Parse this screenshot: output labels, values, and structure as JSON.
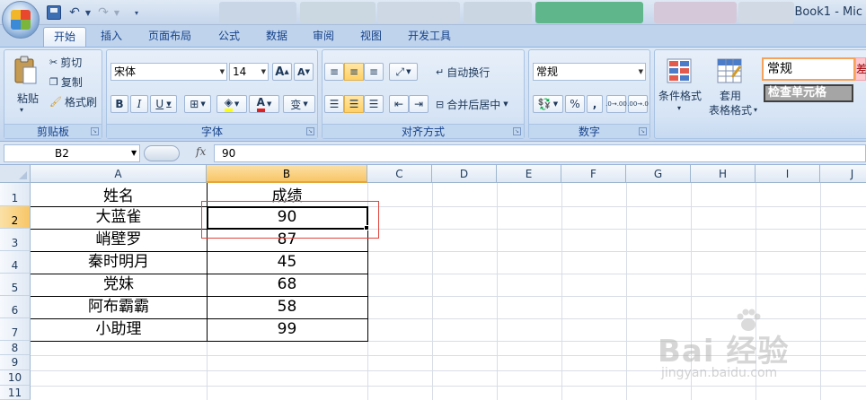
{
  "window": {
    "title": "Book1 - Mic"
  },
  "ribbon_tabs": [
    "开始",
    "插入",
    "页面布局",
    "公式",
    "数据",
    "审阅",
    "视图",
    "开发工具"
  ],
  "clipboard": {
    "paste": "粘贴",
    "cut": "剪切",
    "copy": "复制",
    "format_painter": "格式刷",
    "group_label": "剪贴板"
  },
  "font": {
    "name": "宋体",
    "size": "14",
    "group_label": "字体",
    "bold": "B",
    "italic": "I",
    "underline": "U",
    "grow": "A",
    "shrink": "A",
    "font_color": "A",
    "phonetic": "变"
  },
  "alignment": {
    "wrap_text": "自动换行",
    "merge_center": "合并后居中",
    "group_label": "对齐方式"
  },
  "number": {
    "format": "常规",
    "percent": "%",
    "comma": ",",
    "inc_decimal": ".0→.00",
    "dec_decimal": ".00→.0",
    "group_label": "数字"
  },
  "styles": {
    "conditional_format": "条件格式",
    "format_as_table_line1": "套用",
    "format_as_table_line2": "表格格式",
    "style_normal": "常规",
    "style_check": "检查单元格",
    "style_extra": "差"
  },
  "formula_bar": {
    "name_box": "B2",
    "fx": "fx",
    "value": "90"
  },
  "columns": [
    "A",
    "B",
    "C",
    "D",
    "E",
    "F",
    "G",
    "H",
    "I",
    "J"
  ],
  "rows": [
    "1",
    "2",
    "3",
    "4",
    "5",
    "6",
    "7",
    "8",
    "9",
    "10",
    "11"
  ],
  "sheet": {
    "header": [
      "姓名",
      "成绩"
    ],
    "data": [
      [
        "大蓝雀",
        "90"
      ],
      [
        "峭壁罗",
        "87"
      ],
      [
        "秦时明月",
        "45"
      ],
      [
        "党妹",
        "68"
      ],
      [
        "阿布霸霸",
        "58"
      ],
      [
        "小助理",
        "99"
      ]
    ]
  },
  "watermark": {
    "brand": "Bai 经验",
    "url": "jingyan.baidu.com"
  }
}
